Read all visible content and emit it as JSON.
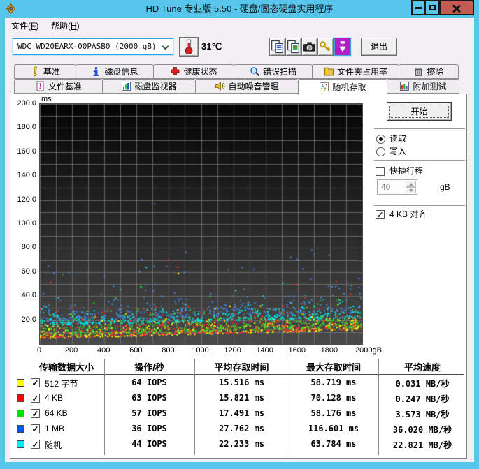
{
  "window": {
    "title": "HD Tune 专业版 5.50 - 硬盘/固态硬盘实用程序"
  },
  "menu": {
    "file": {
      "pre": "文件(",
      "key": "F",
      "post": ")"
    },
    "help": {
      "pre": "帮助(",
      "key": "H",
      "post": ")"
    }
  },
  "toolbar": {
    "drive": "WDC WD20EARX-00PASB0  (2000 gB)",
    "temperature": "31℃",
    "exit": "退出"
  },
  "tabs": {
    "row1": [
      {
        "label": "基准",
        "icon": "benchmark-icon"
      },
      {
        "label": "磁盘信息",
        "icon": "disk-info-icon"
      },
      {
        "label": "健康状态",
        "icon": "health-icon"
      },
      {
        "label": "错误扫描",
        "icon": "error-scan-icon"
      },
      {
        "label": "文件夹占用率",
        "icon": "folder-usage-icon"
      },
      {
        "label": "擦除",
        "icon": "erase-icon"
      }
    ],
    "row2": [
      {
        "label": "文件基准",
        "icon": "file-benchmark-icon"
      },
      {
        "label": "磁盘监视器",
        "icon": "disk-monitor-icon"
      },
      {
        "label": "自动噪音管理",
        "icon": "noise-management-icon"
      },
      {
        "label": "随机存取",
        "icon": "random-access-icon",
        "active": true
      },
      {
        "label": "附加测试",
        "icon": "extra-tests-icon"
      }
    ]
  },
  "controls": {
    "start": "开始",
    "read": "读取",
    "write": "写入",
    "short_stroke": "快捷行程",
    "short_stroke_value": "40",
    "short_stroke_unit": "gB",
    "align": "4 KB 对齐",
    "check_glyph": "✓"
  },
  "table": {
    "headers": [
      "传输数据大小",
      "操作/秒",
      "平均存取时间",
      "最大存取时间",
      "平均速度"
    ],
    "rows": [
      {
        "swatch": "#ffff00",
        "label": "512 字节",
        "iops": "64 IOPS",
        "avg": "15.516 ms",
        "max": "58.719 ms",
        "speed": "0.031 MB/秒"
      },
      {
        "swatch": "#ff0000",
        "label": "4 KB",
        "iops": "63 IOPS",
        "avg": "15.821 ms",
        "max": "70.128 ms",
        "speed": "0.247 MB/秒"
      },
      {
        "swatch": "#00dd00",
        "label": "64 KB",
        "iops": "57 IOPS",
        "avg": "17.491 ms",
        "max": "58.176 ms",
        "speed": "3.573 MB/秒"
      },
      {
        "swatch": "#0055ee",
        "label": "1 MB",
        "iops": "36 IOPS",
        "avg": "27.762 ms",
        "max": "116.601 ms",
        "speed": "36.020 MB/秒"
      },
      {
        "swatch": "#00eeee",
        "label": "随机",
        "iops": "44 IOPS",
        "avg": "22.233 ms",
        "max": "63.784 ms",
        "speed": "22.821 MB/秒"
      }
    ]
  },
  "chart_data": {
    "type": "scatter",
    "title": "",
    "ylabel": "ms",
    "xlabel": "gB",
    "xlim": [
      0,
      2000
    ],
    "ylim": [
      0,
      200
    ],
    "x_grid_step": 100,
    "y_grid_step": 10,
    "grid": true,
    "x_ticks": [
      0,
      200,
      400,
      600,
      800,
      1000,
      1200,
      1400,
      1600,
      1800,
      2000
    ],
    "x_tick_labels": [
      "0",
      "200",
      "400",
      "600",
      "800",
      "1000",
      "1200",
      "1400",
      "1600",
      "1800",
      "2000gB"
    ],
    "y_ticks": [
      200,
      180,
      160,
      140,
      120,
      100,
      80,
      60,
      40,
      20
    ],
    "y_tick_labels": [
      "200.0",
      "180.0",
      "160.0",
      "140.0",
      "120.0",
      "100.0",
      "80.0",
      "60.0",
      "40.0",
      "20.0"
    ],
    "bg_gradient": [
      "#050505",
      "#4a4a4a"
    ],
    "grid_color": "#7a7a7a",
    "legend_position": "bottom-table",
    "series": [
      {
        "name": "512 字节",
        "color": "#ffff00",
        "point_color": "#ffff00",
        "iops": 64,
        "avg_ms": 15.516,
        "max_ms": 58.719,
        "avg_speed_mb_s": 0.031,
        "sim": {
          "n": 420,
          "floor0": 4.5,
          "floor_slope": 7,
          "spread": 5.0,
          "outlier_p": 0.02,
          "outlier_mag": 26,
          "max_x_frac": 0.43,
          "seed": 1
        }
      },
      {
        "name": "4 KB",
        "color": "#ff0000",
        "point_color": "#ff3030",
        "iops": 63,
        "avg_ms": 15.821,
        "max_ms": 70.128,
        "avg_speed_mb_s": 0.247,
        "sim": {
          "n": 420,
          "floor0": 4.8,
          "floor_slope": 7,
          "spread": 5.0,
          "outlier_p": 0.02,
          "outlier_mag": 28,
          "max_x_frac": 0.4,
          "seed": 2
        }
      },
      {
        "name": "64 KB",
        "color": "#00dd00",
        "point_color": "#2ed42e",
        "iops": 57,
        "avg_ms": 17.491,
        "max_ms": 58.176,
        "avg_speed_mb_s": 3.573,
        "sim": {
          "n": 420,
          "floor0": 6.8,
          "floor_slope": 7,
          "spread": 5.0,
          "outlier_p": 0.02,
          "outlier_mag": 24,
          "max_x_frac": 0.07,
          "seed": 3
        }
      },
      {
        "name": "1 MB",
        "color": "#0055ee",
        "point_color": "#4488ee",
        "iops": 36,
        "avg_ms": 27.762,
        "max_ms": 116.601,
        "avg_speed_mb_s": 36.02,
        "sim": {
          "n": 340,
          "floor0": 19,
          "floor_slope": 7,
          "spread": 6.5,
          "outlier_p": 0.08,
          "outlier_mag": 45,
          "max_x_frac": 0.356,
          "seed": 4
        }
      },
      {
        "name": "随机",
        "color": "#00eeee",
        "point_color": "#00e8e8",
        "iops": 44,
        "avg_ms": 22.233,
        "max_ms": 63.784,
        "avg_speed_mb_s": 22.821,
        "sim": {
          "n": 360,
          "floor0": 15.5,
          "floor_slope": 6,
          "spread": 3.5,
          "outlier_p": 0.05,
          "outlier_mag": 22,
          "max_x_frac": 0.33,
          "seed": 5
        }
      }
    ]
  }
}
